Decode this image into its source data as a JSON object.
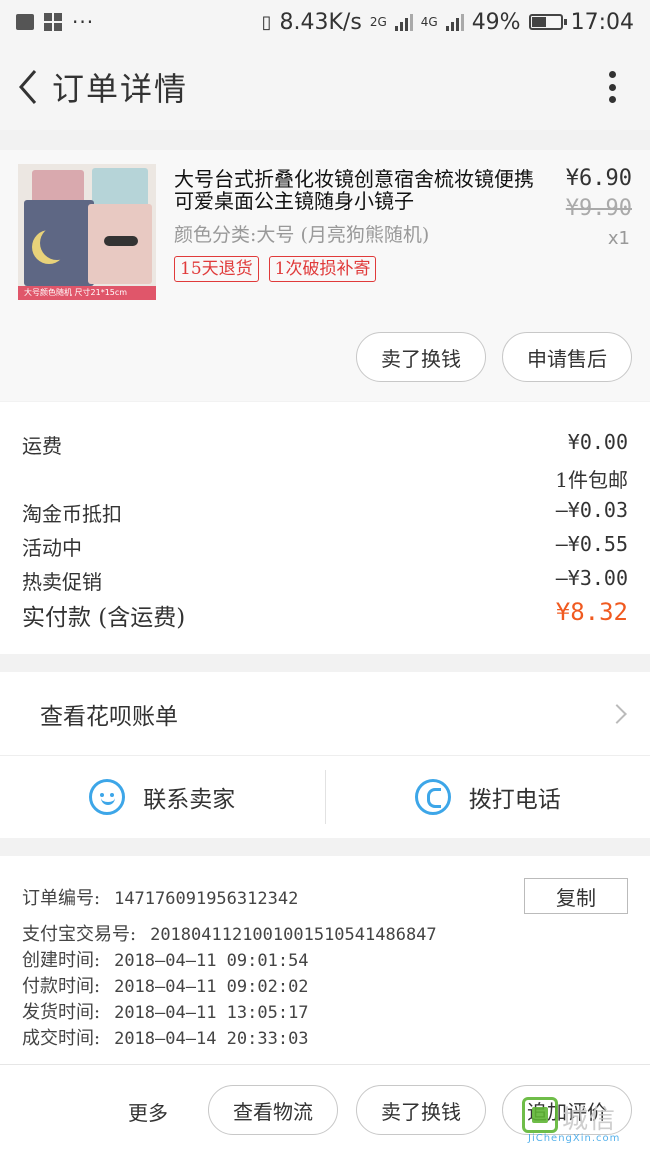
{
  "status_bar": {
    "speed": "8.43K/s",
    "net1": "2G",
    "net2": "4G",
    "battery": "49%",
    "battery_level": 0.49,
    "time": "17:04"
  },
  "navbar": {
    "title": "订单详情"
  },
  "product": {
    "image_caption": "大号颜色随机 尺寸21*15cm",
    "title": "大号台式折叠化妆镜创意宿舍梳妆镜便携可爱桌面公主镜随身小镜子",
    "sku": "颜色分类:大号 (月亮狗熊随机)",
    "tags": [
      "15天退货",
      "1次破损补寄"
    ],
    "price": "¥6.90",
    "original_price": "¥9.90",
    "quantity": "x1",
    "sell_label": "卖了换钱",
    "aftersale_label": "申请售后"
  },
  "fees": {
    "shipping_label": "运费",
    "shipping_value": "¥0.00",
    "shipping_note": "1件包邮",
    "coin_label": "淘金币抵扣",
    "coin_value": "—¥0.03",
    "activity_label": "活动中",
    "activity_value": "—¥0.55",
    "promo_label": "热卖促销",
    "promo_value": "—¥3.00",
    "total_label": "实付款 (含运费)",
    "total_value": "¥8.32"
  },
  "huabei": {
    "label": "查看花呗账单"
  },
  "contact": {
    "seller_label": "联系卖家",
    "phone_label": "拨打电话"
  },
  "order_info": {
    "order_no_label": "订单编号:",
    "order_no": "147176091956312342",
    "copy_label": "复制",
    "alipay_label": "支付宝交易号:",
    "alipay_no": "2018041121001001510541486847",
    "created_label": "创建时间:",
    "created": "2018—04—11 09:01:54",
    "paid_label": "付款时间:",
    "paid": "2018—04—11 09:02:02",
    "shipped_label": "发货时间:",
    "shipped": "2018—04—11 13:05:17",
    "done_label": "成交时间:",
    "done": "2018—04—14 20:33:03"
  },
  "bottom_bar": {
    "more_label": "更多",
    "logistics_label": "查看物流",
    "sell_label": "卖了换钱",
    "review_label": "追加评价"
  },
  "watermark": {
    "cn": "城信",
    "en": "JiChengXin.com"
  }
}
